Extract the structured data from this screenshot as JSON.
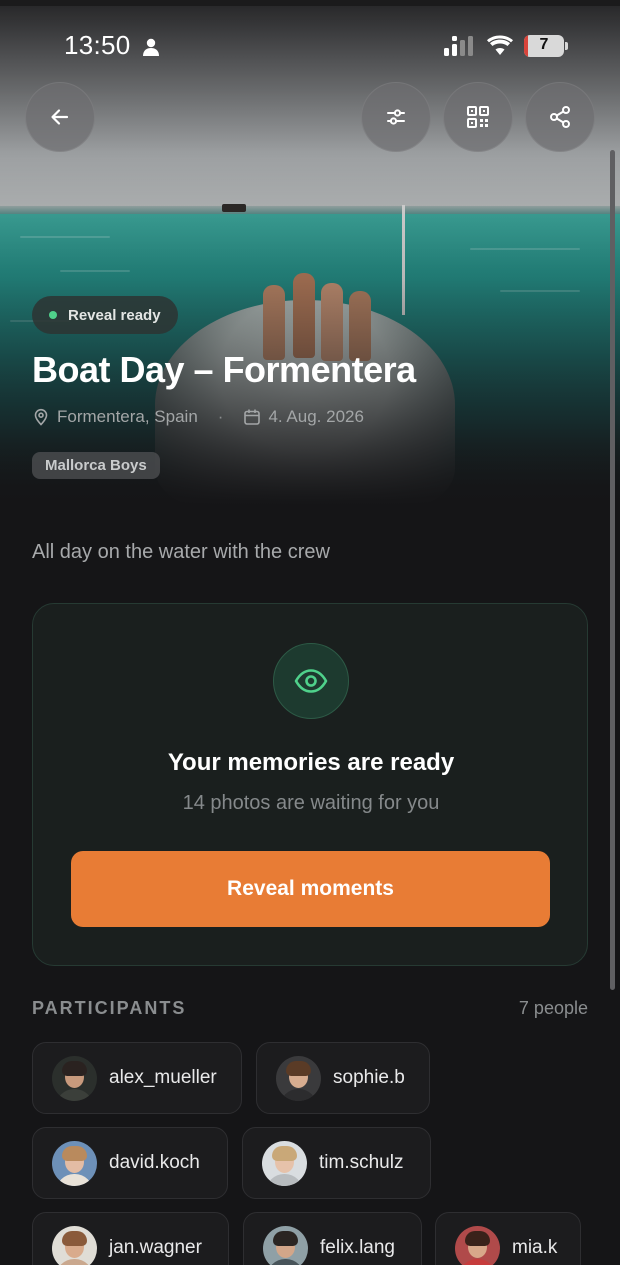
{
  "status_bar": {
    "time": "13:50",
    "battery_level": "7",
    "icons": [
      "person-icon",
      "signal-icon",
      "wifi-icon",
      "battery-icon"
    ]
  },
  "header_actions": {
    "back": {
      "icon": "arrow-left-icon"
    },
    "filter": {
      "icon": "sliders-icon"
    },
    "qr": {
      "icon": "qr-code-icon"
    },
    "share": {
      "icon": "share-icon"
    }
  },
  "event": {
    "status_label": "Reveal ready",
    "status_color": "#4fd18b",
    "title": "Boat Day – Formentera",
    "location": "Formentera, Spain",
    "date": "4. Aug. 2026",
    "group": "Mallorca Boys",
    "description": "All day on the water with the crew"
  },
  "reveal_card": {
    "icon": "eye-icon",
    "title": "Your memories are ready",
    "subtitle": "14 photos are waiting for you",
    "button_label": "Reveal moments",
    "accent_color": "#e87c35"
  },
  "participants": {
    "heading": "PARTICIPANTS",
    "count_label": "7 people",
    "people": [
      {
        "name": "alex_mueller"
      },
      {
        "name": "sophie.b"
      },
      {
        "name": "david.koch"
      },
      {
        "name": "tim.schulz"
      },
      {
        "name": "jan.wagner"
      },
      {
        "name": "felix.lang"
      },
      {
        "name": "mia.k"
      }
    ]
  }
}
